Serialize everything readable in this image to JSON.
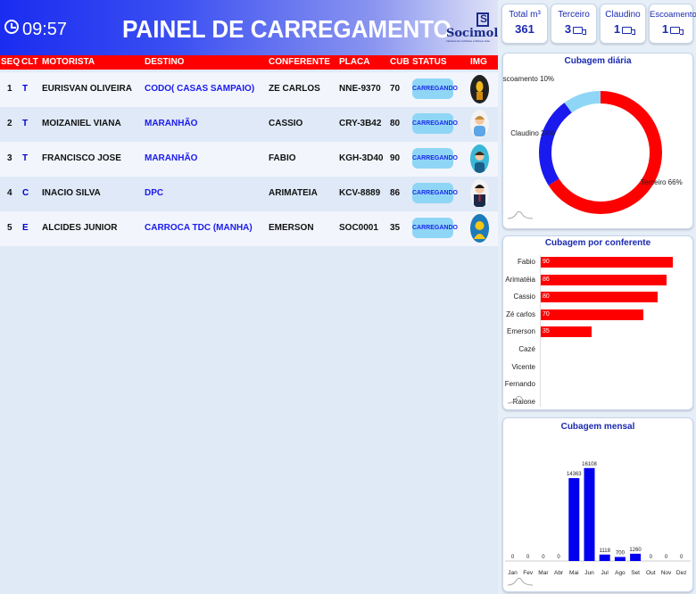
{
  "header": {
    "time": "09:57",
    "title": "PAINEL DE CARREGAMENTO",
    "logo_word": "Socimol",
    "logo_tag": "Indústria de Colchões e Móveis Ltda."
  },
  "table": {
    "columns": [
      "SEQ",
      "CLT",
      "MOTORISTA",
      "DESTINO",
      "CONFERENTE",
      "PLACA",
      "CUB",
      "STATUS",
      "IMG"
    ],
    "rows": [
      {
        "seq": "1",
        "clt": "T",
        "motorista": "EURISVAN OLIVEIRA",
        "destino": "CODO( CASAS SAMPAIO)",
        "conferente": "ZE CARLOS",
        "placa": "NNE-9370",
        "cub": "70",
        "status": "CARREGANDO",
        "avatar": "dark-figure"
      },
      {
        "seq": "2",
        "clt": "T",
        "motorista": "MOIZANIEL VIANA",
        "destino": "MARANHÃO",
        "conferente": "CASSIO",
        "placa": "CRY-3B42",
        "cub": "80",
        "status": "CARREGANDO",
        "avatar": "man-light"
      },
      {
        "seq": "3",
        "clt": "T",
        "motorista": "FRANCISCO JOSE",
        "destino": "MARANHÃO",
        "conferente": "FABIO",
        "placa": "KGH-3D40",
        "cub": "90",
        "status": "CARREGANDO",
        "avatar": "man-teal"
      },
      {
        "seq": "4",
        "clt": "C",
        "motorista": "INACIO SILVA",
        "destino": "DPC",
        "conferente": "ARIMATEIA",
        "placa": "KCV-8889",
        "cub": "86",
        "status": "CARREGANDO",
        "avatar": "man-suit"
      },
      {
        "seq": "5",
        "clt": "E",
        "motorista": "ALCIDES JUNIOR",
        "destino": "CARROCA TDC (MANHA)",
        "conferente": "EMERSON",
        "placa": "SOC0001",
        "cub": "35",
        "status": "CARREGANDO",
        "avatar": "person-yellow"
      }
    ]
  },
  "kpis": [
    {
      "label": "Total m³",
      "value": "361",
      "truck": false
    },
    {
      "label": "Terceiro",
      "value": "3",
      "truck": true
    },
    {
      "label": "Claudino",
      "value": "1",
      "truck": true
    },
    {
      "label": "Escoamento",
      "value": "1",
      "truck": true
    }
  ],
  "chart_data": [
    {
      "type": "pie",
      "title": "Cubagem diária",
      "labels": [
        "Terceiro 66%",
        "Claudino 24%",
        "Escoamento 10%"
      ],
      "values": [
        66,
        24,
        10
      ],
      "colors": [
        "#ff0000",
        "#1a1aee",
        "#8fd6f6"
      ]
    },
    {
      "type": "bar",
      "orientation": "horizontal",
      "title": "Cubagem por conferente",
      "categories": [
        "Fabio",
        "Arimatéia",
        "Cassio",
        "Zé carlos",
        "Emerson",
        "Cazé",
        "Vicente",
        "Fernando",
        "Raione"
      ],
      "values": [
        90,
        86,
        80,
        70,
        35,
        null,
        null,
        null,
        null
      ],
      "color": "#ff0000"
    },
    {
      "type": "bar",
      "title": "Cubagem mensal",
      "categories": [
        "Jan",
        "Fev",
        "Mar",
        "Abr",
        "Mai",
        "Jun",
        "Jul",
        "Ago",
        "Set",
        "Out",
        "Nov",
        "Dez"
      ],
      "values": [
        0,
        0,
        0,
        0,
        14363,
        16108,
        1118,
        700,
        1260,
        0,
        0,
        0
      ],
      "color": "#0000ee"
    }
  ]
}
